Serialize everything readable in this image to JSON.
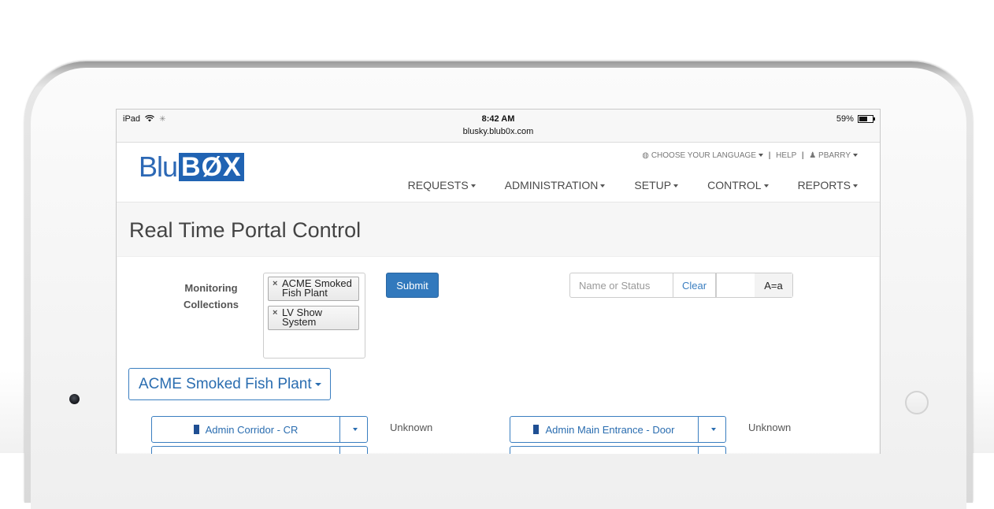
{
  "status_bar": {
    "device": "iPad",
    "time": "8:42 AM",
    "url": "blusky.blub0x.com",
    "battery": "59%"
  },
  "header": {
    "logo_left": "Blu",
    "logo_right": "BØX",
    "language": "CHOOSE YOUR LANGUAGE",
    "help": "HELP",
    "user": "PBARRY",
    "nav": [
      "REQUESTS",
      "ADMINISTRATION",
      "SETUP",
      "CONTROL",
      "REPORTS"
    ]
  },
  "page": {
    "title": "Real Time Portal Control"
  },
  "monitoring": {
    "label_line1": "Monitoring",
    "label_line2": "Collections",
    "collections": [
      {
        "line1": "ACME Smoked",
        "line2": "Fish Plant"
      },
      {
        "line1": "LV Show",
        "line2": "System"
      }
    ],
    "submit_label": "Submit"
  },
  "filter": {
    "placeholder": "Name or Status",
    "clear_label": "Clear",
    "case_label": "A=a"
  },
  "site": {
    "label": "ACME Smoked Fish Plant"
  },
  "portals": [
    {
      "name": "Admin Corridor - CR",
      "status": "Unknown"
    },
    {
      "name": "Admin Main Entrance - Door",
      "status": "Unknown"
    }
  ],
  "colors": {
    "brand_blue": "#2063b3",
    "link_blue": "#3a7ec0",
    "submit_blue": "#3279bd"
  }
}
